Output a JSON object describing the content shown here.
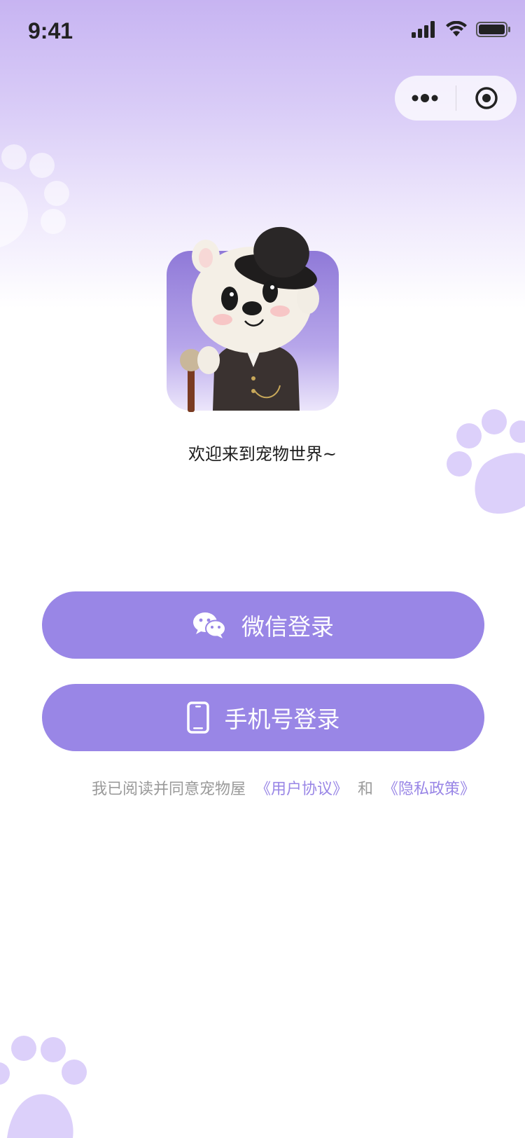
{
  "status_bar": {
    "time": "9:41"
  },
  "welcome_text": "欢迎来到宠物世界~",
  "buttons": {
    "wechat_login": "微信登录",
    "phone_login": "手机号登录"
  },
  "agreement": {
    "prefix": "我已阅读并同意宠物屋",
    "user_agreement": "《用户协议》",
    "and": "和",
    "privacy_policy": "《隐私政策》"
  },
  "colors": {
    "accent": "#9986e6",
    "gradient_top": "#c7b4f2",
    "paw": "#dcd0fa"
  },
  "icons": [
    "signal-icon",
    "wifi-icon",
    "battery-icon",
    "more-icon",
    "target-icon",
    "wechat-icon",
    "phone-icon",
    "paw-icon"
  ]
}
